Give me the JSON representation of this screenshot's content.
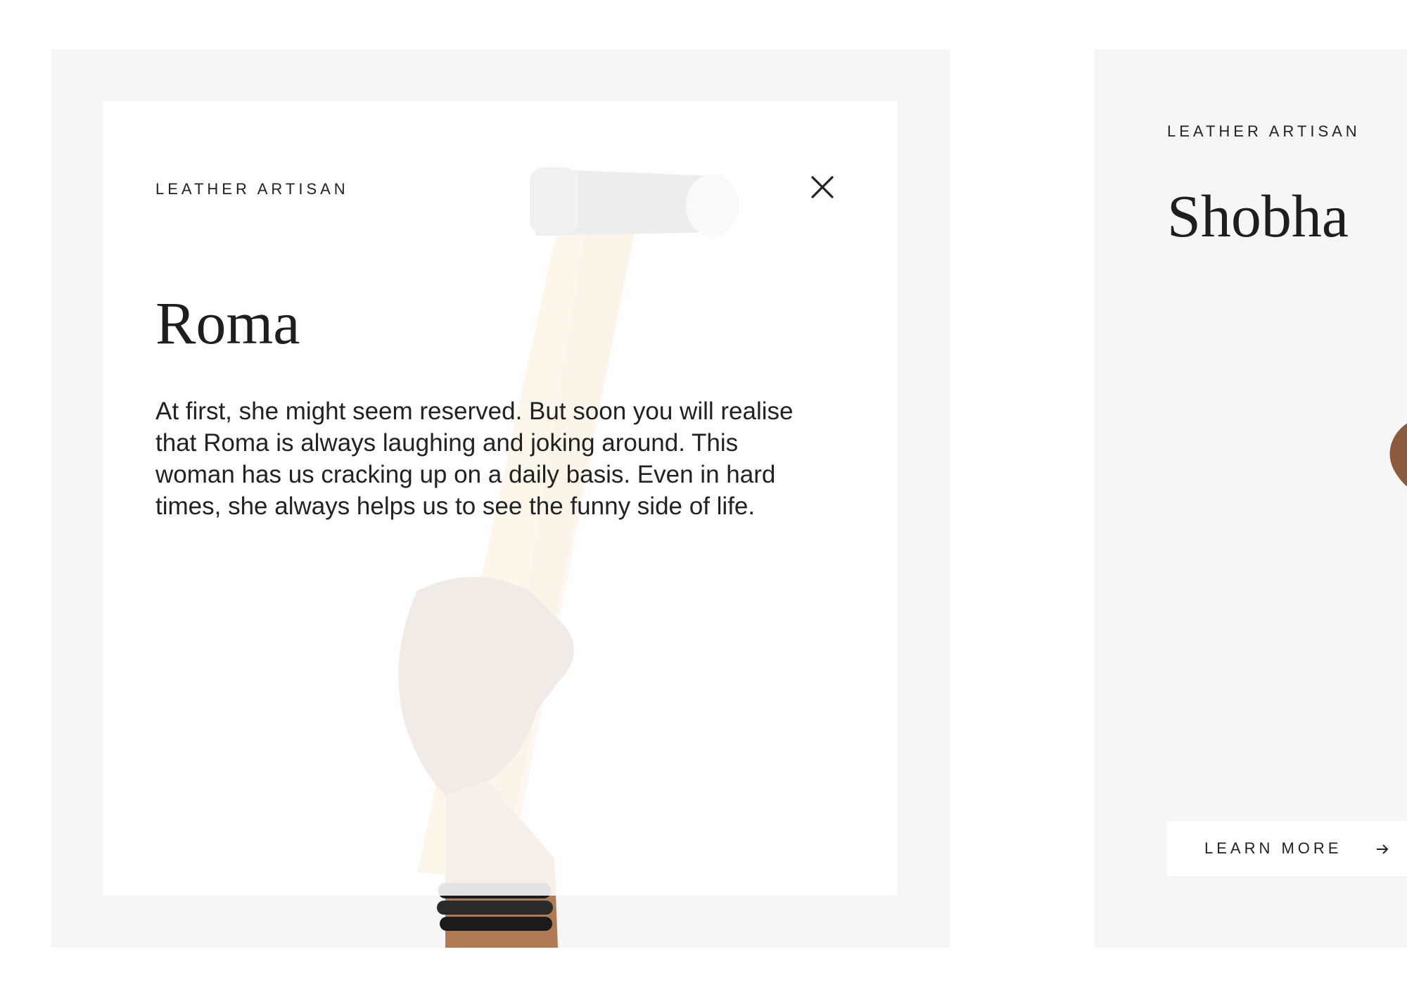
{
  "cards": [
    {
      "role": "LEATHER ARTISAN",
      "name": "Roma",
      "bio": "At first, she might seem reserved. But soon you will realise that Roma is always laughing and joking around. This woman has us cracking up on a daily basis. Even in hard times, she always helps us to see the funny side of life.",
      "state": "expanded",
      "icons": [
        "close-icon"
      ]
    },
    {
      "role": "LEATHER ARTISAN",
      "name": "Shobha",
      "cta_label": "LEARN MORE",
      "state": "collapsed",
      "icons": [
        "arrow-right-icon"
      ]
    }
  ],
  "colors": {
    "page_background": "#ffffff",
    "card_background": "#f6f6f6",
    "text": "#222222",
    "hammer_handle": "#e8b45a"
  }
}
